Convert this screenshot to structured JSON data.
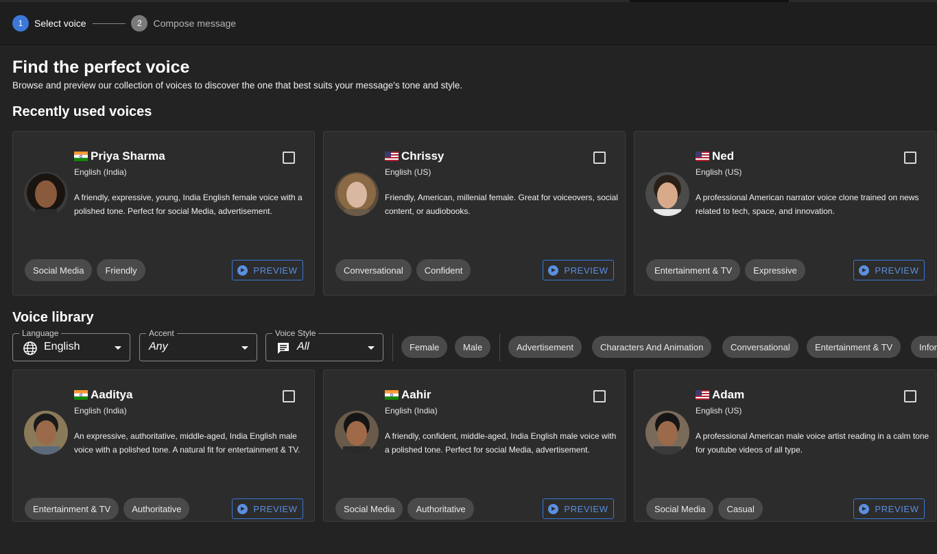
{
  "stepper": {
    "steps": [
      {
        "number": "1",
        "label": "Select voice"
      },
      {
        "number": "2",
        "label": "Compose message"
      }
    ]
  },
  "header": {
    "title": "Find the perfect voice",
    "subtitle": "Browse and preview our collection of voices to discover the one that best suits your message's tone and style."
  },
  "recent": {
    "title": "Recently used voices",
    "cards": [
      {
        "name": "Priya Sharma",
        "flag": "india-flag",
        "language": "English (India)",
        "description": "A friendly, expressive, young, India English female voice with a polished tone. Perfect for social Media, advertisement.",
        "tags": [
          "Social Media",
          "Friendly"
        ],
        "preview": "PREVIEW"
      },
      {
        "name": "Chrissy",
        "flag": "us-flag",
        "language": "English (US)",
        "description": "Friendly, American, millenial female. Great for voiceovers, social content, or audiobooks.",
        "tags": [
          "Conversational",
          "Confident"
        ],
        "preview": "PREVIEW"
      },
      {
        "name": "Ned",
        "flag": "us-flag",
        "language": "English (US)",
        "description": "A professional American narrator voice clone trained on news related to tech, space, and innovation.",
        "tags": [
          "Entertainment & TV",
          "Expressive"
        ],
        "preview": "PREVIEW"
      }
    ]
  },
  "library": {
    "title": "Voice library",
    "filters": {
      "language": {
        "label": "Language",
        "value": "English"
      },
      "accent": {
        "label": "Accent",
        "value": "Any"
      },
      "style": {
        "label": "Voice Style",
        "value": "All"
      }
    },
    "chips": [
      "Female",
      "Male",
      "Advertisement",
      "Characters And Animation",
      "Conversational",
      "Entertainment & TV",
      "Infor"
    ],
    "cards": [
      {
        "name": "Aaditya",
        "flag": "india-flag",
        "language": "English (India)",
        "description": "An expressive, authoritative, middle-aged, India English male voice with a polished tone. A natural fit for entertainment & TV.",
        "tags": [
          "Entertainment & TV",
          "Authoritative"
        ],
        "preview": "PREVIEW"
      },
      {
        "name": "Aahir",
        "flag": "india-flag",
        "language": "English (India)",
        "description": "A friendly, confident, middle-aged, India English male voice with a polished tone. Perfect for social Media, advertisement.",
        "tags": [
          "Social Media",
          "Authoritative"
        ],
        "preview": "PREVIEW"
      },
      {
        "name": "Adam",
        "flag": "us-flag",
        "language": "English (US)",
        "description": "A professional American male voice artist reading in a calm tone for youtube videos of all type.",
        "tags": [
          "Social Media",
          "Casual"
        ],
        "preview": "PREVIEW"
      }
    ]
  },
  "colors": {
    "accent": "#3b78d8",
    "background": "#232323",
    "card": "#2c2c2c",
    "chip": "#4a4a4a"
  }
}
